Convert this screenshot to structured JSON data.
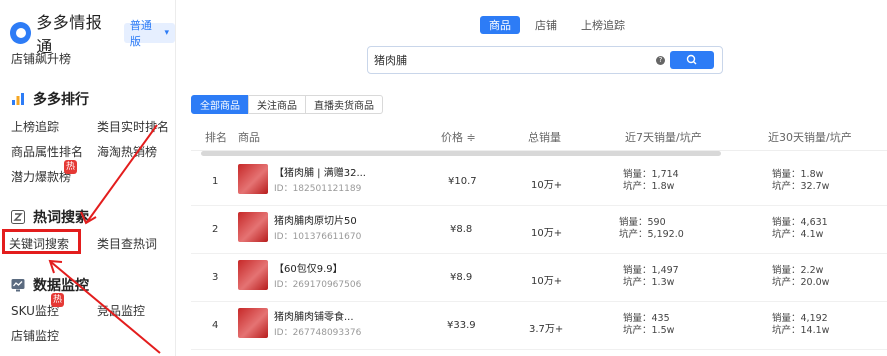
{
  "brand": {
    "name": "多多情报通",
    "edition": "普通版"
  },
  "sidebar": {
    "top_link": "店铺飙升榜",
    "rank_section": {
      "title": "多多排行",
      "items": [
        "上榜追踪",
        "类目实时排名",
        "商品属性排名",
        "海淘热销榜",
        "潜力爆款榜"
      ],
      "badge": "热"
    },
    "search_section": {
      "title": "热词搜索",
      "items": [
        "关键词搜索",
        "类目查热词"
      ]
    },
    "monitor_section": {
      "title": "数据监控",
      "items": [
        "SKU监控",
        "竞品监控",
        "店铺监控"
      ],
      "badge": "热"
    }
  },
  "top_tabs": [
    "商品",
    "店铺",
    "上榜追踪"
  ],
  "search": {
    "value": "猪肉脯"
  },
  "sub_tabs": [
    "全部商品",
    "关注商品",
    "直播卖货商品"
  ],
  "table": {
    "headers": [
      "排名",
      "商品",
      "价格 ≑",
      "总销量",
      "近7天销量/坑产",
      "近30天销量/坑产"
    ],
    "rows": [
      {
        "rank": "1",
        "name": "【猪肉脯 | 满赠32...",
        "id": "ID：182501121189",
        "price": "¥10.7",
        "total": "10万+",
        "d7_sales": "销量：1,714",
        "d7_gmv": "坑产：1.8w",
        "d30_sales": "销量：1.8w",
        "d30_gmv": "坑产：32.7w"
      },
      {
        "rank": "2",
        "name": "猪肉脯肉原切片50",
        "id": "ID：101376611670",
        "price": "¥8.8",
        "total": "10万+",
        "d7_sales": "销量：590",
        "d7_gmv": "坑产：5,192.0",
        "d30_sales": "销量：4,631",
        "d30_gmv": "坑产：4.1w"
      },
      {
        "rank": "3",
        "name": "【60包仅9.9】",
        "id": "ID：269170967506",
        "price": "¥8.9",
        "total": "10万+",
        "d7_sales": "销量：1,497",
        "d7_gmv": "坑产：1.3w",
        "d30_sales": "销量：2.2w",
        "d30_gmv": "坑产：20.0w"
      },
      {
        "rank": "4",
        "name": "猪肉脯肉铺零食...",
        "id": "ID：267748093376",
        "price": "¥33.9",
        "total": "3.7万+",
        "d7_sales": "销量：435",
        "d7_gmv": "坑产：1.5w",
        "d30_sales": "销量：4,192",
        "d30_gmv": "坑产：14.1w"
      }
    ]
  },
  "colors": {
    "accent": "#2d7cf6",
    "annotation": "#e31d1d",
    "badge": "#e53935"
  }
}
